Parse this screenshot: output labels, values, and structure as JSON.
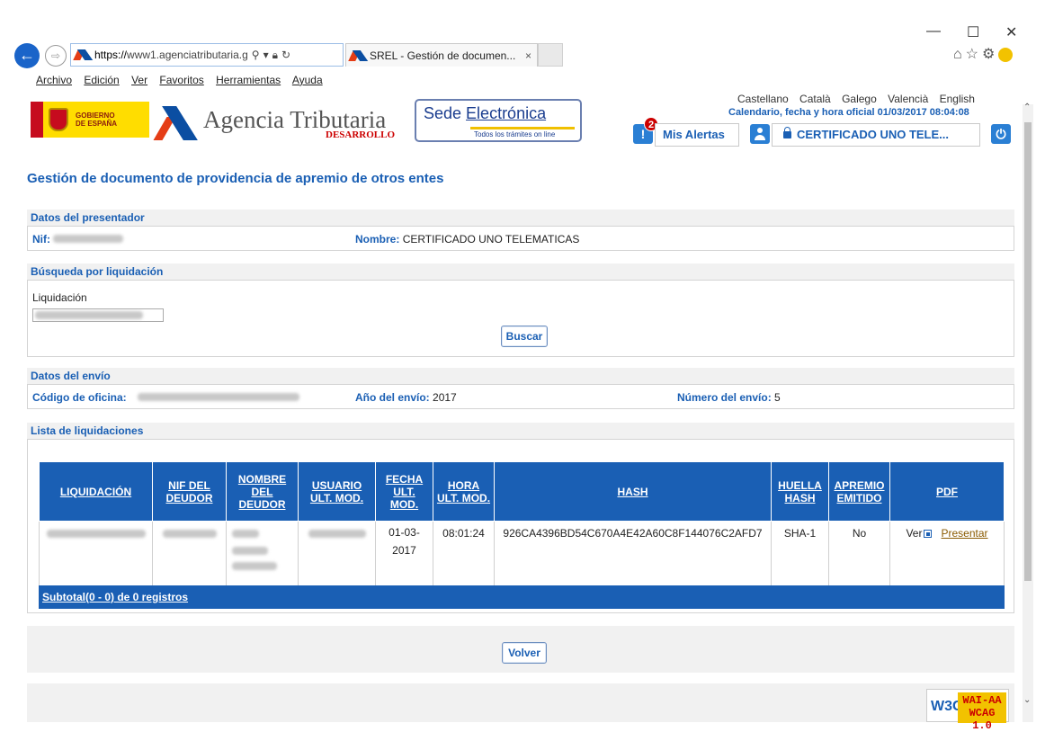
{
  "browser": {
    "url_https": "https://",
    "url_rest": "www1.agenciatributaria.g",
    "tab_title": "SREL - Gestión de documen...",
    "menu": [
      "Archivo",
      "Edición",
      "Ver",
      "Favoritos",
      "Herramientas",
      "Ayuda"
    ]
  },
  "header": {
    "gobierno_line1": "GOBIERNO",
    "gobierno_line2": "DE ESPAÑA",
    "agency_name": "Agencia Tributaria",
    "agency_env": "DESARROLLO",
    "sede_title_1": "Sede ",
    "sede_title_2": "Electrónica",
    "sede_subtitle": "Todos los trámites on line",
    "languages": [
      "Castellano",
      "Català",
      "Galego",
      "Valencià",
      "English"
    ],
    "calendar": "Calendario, fecha y hora oficial 01/03/2017 08:04:08",
    "alerts_count": "2",
    "alerts_label": "Mis Alertas",
    "cert_label": "CERTIFICADO UNO TELE..."
  },
  "page": {
    "title": "Gestión de documento de providencia de apremio de otros entes",
    "presentador": {
      "section": "Datos del presentador",
      "nif_label": "Nif:",
      "nombre_label": "Nombre:",
      "nombre_value": "CERTIFICADO UNO TELEMATICAS"
    },
    "busqueda": {
      "section": "Búsqueda por liquidación",
      "field_label": "Liquidación",
      "search_button": "Buscar"
    },
    "envio": {
      "section": "Datos del envío",
      "oficina_label": "Código de oficina:",
      "anio_label": "Año del envío:",
      "anio_value": "2017",
      "numero_label": "Número del envío:",
      "numero_value": "5"
    },
    "lista": {
      "section": "Lista de liquidaciones",
      "columns": [
        "LIQUIDACIÓN",
        "NIF DEL DEUDOR",
        "NOMBRE DEL DEUDOR",
        "USUARIO ULT. MOD.",
        "FECHA ULT. MOD.",
        "HORA ULT. MOD.",
        "HASH",
        "HUELLA HASH",
        "APREMIO EMITIDO",
        "PDF"
      ],
      "row": {
        "fecha": "01-03-2017",
        "hora": "08:01:24",
        "hash": "926CA4396BD54C670A4E42A60C8F144076C2AFD7",
        "huella": "SHA-1",
        "apremio": "No",
        "ver": "Ver",
        "presentar": "Presentar"
      },
      "subtotal": "Subtotal(0 - 0) de 0 registros"
    },
    "back_button": "Volver"
  },
  "footer": {
    "w3c": "W3C",
    "wai": "WAI-AA",
    "wcag": "WCAG 1.0"
  },
  "colors": {
    "accent": "#1a5fb4",
    "table_header": "#1a5fb4",
    "section_band": "#f1f1f1"
  }
}
